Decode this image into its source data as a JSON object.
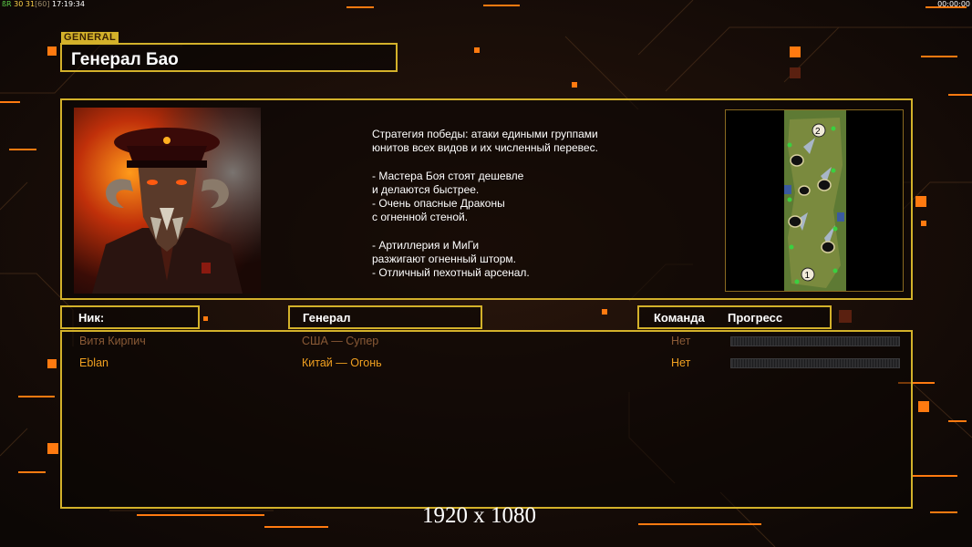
{
  "hud": {
    "fps_label": "ßR",
    "fps_values": "30 31",
    "fps_limit": "[60]",
    "clock": "17:19:34",
    "timer": "00:00:00"
  },
  "section_tag": "GENERAL",
  "title": "Генерал Бао",
  "description": "Стратегия победы: атаки едиными группами\nюнитов всех видов и их численный перевес.\n\n- Мастера Боя стоят дешевле\nи делаются быстрее.\n- Очень опасные Драконы\nс огненной стеной.\n\n- Артиллерия и МиГи\nразжигают огненный шторм.\n- Отличный пехотный арсенал.",
  "minimap": {
    "start_positions": [
      "2",
      "1"
    ]
  },
  "table": {
    "headers": {
      "nick": "Ник:",
      "general": "Генерал",
      "team": "Команда",
      "progress": "Прогресс"
    },
    "rows": [
      {
        "nick": "Витя Кирпич",
        "general": "США — Супер",
        "team": "Нет",
        "progress": 0
      },
      {
        "nick": "Eblan",
        "general": "Китай — Огонь",
        "team": "Нет",
        "progress": 0
      }
    ]
  },
  "row_colors": [
    "#8a5a36",
    "#f0a020"
  ],
  "resolution": "1920 x 1080",
  "colors": {
    "accent": "#d3b12a",
    "orange": "#ff7a10",
    "bg": "#0f0906"
  }
}
